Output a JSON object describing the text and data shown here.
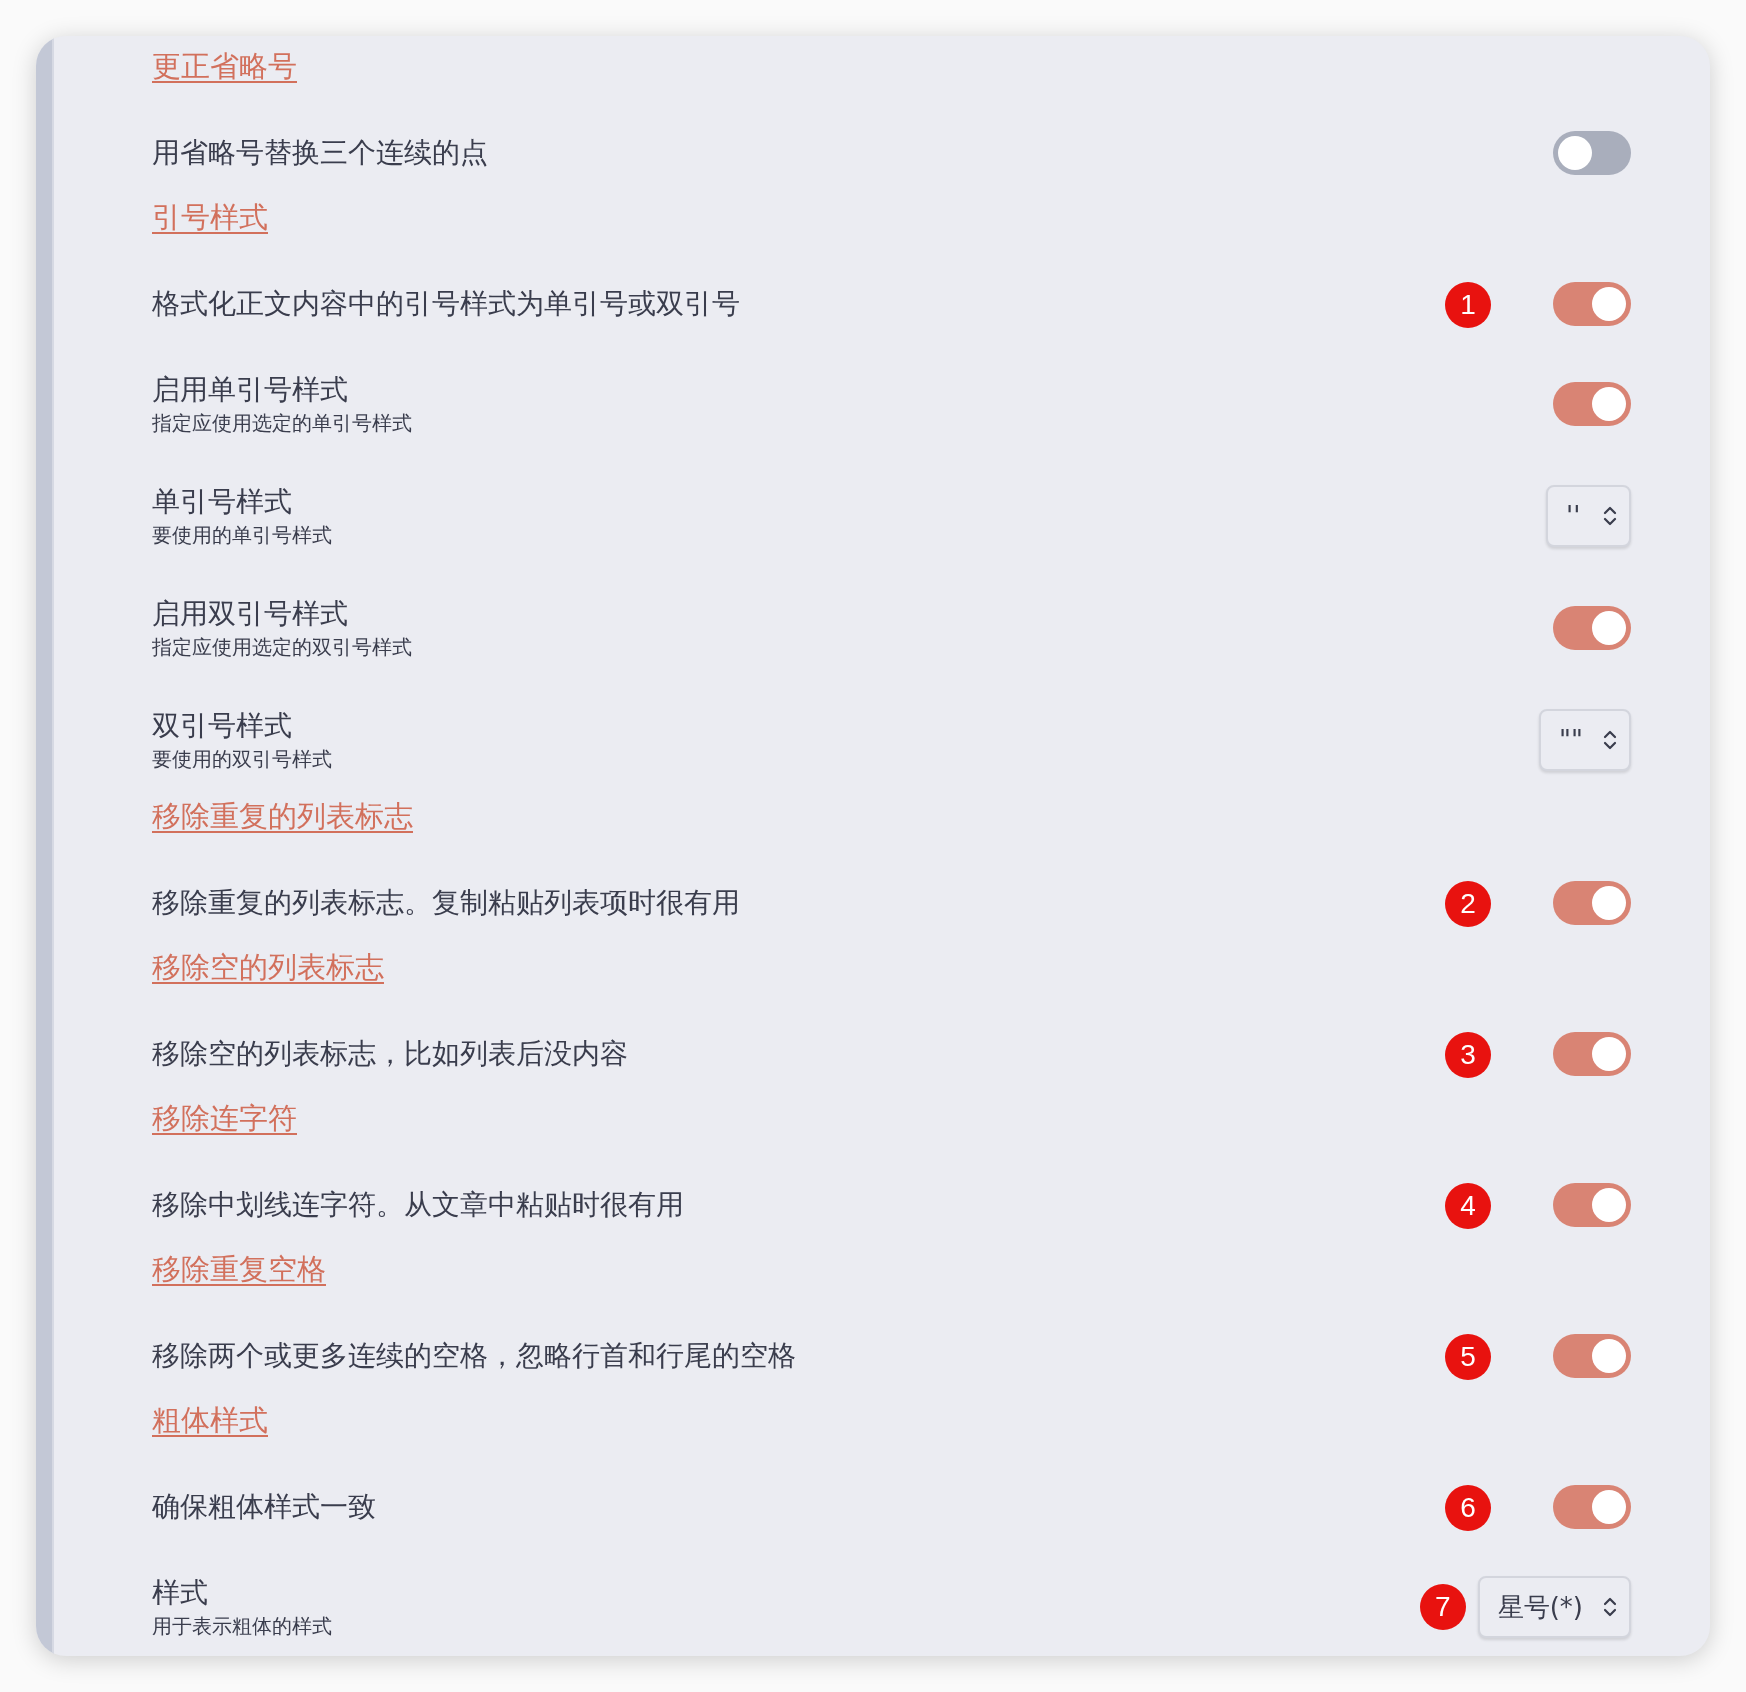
{
  "items": [
    {
      "kind": "heading",
      "text": "更正省略号"
    },
    {
      "kind": "toggle",
      "label": "用省略号替换三个连续的点",
      "on": false
    },
    {
      "kind": "heading",
      "text": "引号样式"
    },
    {
      "kind": "toggle",
      "label": "格式化正文内容中的引号样式为单引号或双引号",
      "on": true,
      "badge": "1"
    },
    {
      "kind": "toggle",
      "label": "启用单引号样式",
      "description": "指定应使用选定的单引号样式",
      "on": true
    },
    {
      "kind": "select",
      "label": "单引号样式",
      "description": "要使用的单引号样式",
      "value": "''"
    },
    {
      "kind": "toggle",
      "label": "启用双引号样式",
      "description": "指定应使用选定的双引号样式",
      "on": true
    },
    {
      "kind": "select",
      "label": "双引号样式",
      "description": "要使用的双引号样式",
      "value": "\"\""
    },
    {
      "kind": "heading",
      "text": "移除重复的列表标志"
    },
    {
      "kind": "toggle",
      "label": "移除重复的列表标志。复制粘贴列表项时很有用",
      "on": true,
      "badge": "2"
    },
    {
      "kind": "heading",
      "text": "移除空的列表标志"
    },
    {
      "kind": "toggle",
      "label": "移除空的列表标志，比如列表后没内容",
      "on": true,
      "badge": "3"
    },
    {
      "kind": "heading",
      "text": "移除连字符"
    },
    {
      "kind": "toggle",
      "label": "移除中划线连字符。从文章中粘贴时很有用",
      "on": true,
      "badge": "4"
    },
    {
      "kind": "heading",
      "text": "移除重复空格"
    },
    {
      "kind": "toggle",
      "label": "移除两个或更多连续的空格，忽略行首和行尾的空格",
      "on": true,
      "badge": "5"
    },
    {
      "kind": "heading",
      "text": "粗体样式"
    },
    {
      "kind": "toggle",
      "label": "确保粗体样式一致",
      "on": true,
      "badge": "6"
    },
    {
      "kind": "select",
      "label": "样式",
      "description": "用于表示粗体的样式",
      "value": "星号(*)",
      "badge": "7"
    }
  ]
}
